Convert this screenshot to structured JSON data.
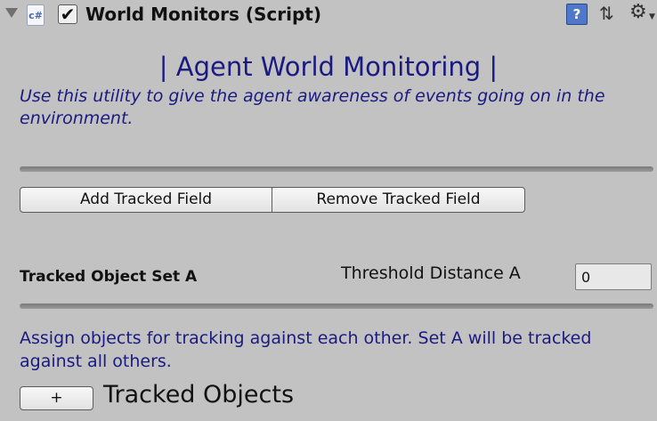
{
  "component": {
    "title": "World Monitors (Script)",
    "script_icon_label": "c#",
    "enabled": true,
    "enabled_glyph": "✔",
    "icons": [
      "foldout-arrow-icon",
      "csharp-script-icon",
      "help-icon",
      "preset-icon",
      "gear-icon"
    ]
  },
  "header": {
    "title": "| Agent World Monitoring |",
    "description": "Use this utility to give the agent awareness of events going on in the environment."
  },
  "buttons": {
    "add_tracked_field": "Add Tracked Field",
    "remove_tracked_field": "Remove Tracked Field"
  },
  "set_a": {
    "label": "Tracked Object Set A",
    "threshold_label": "Threshold Distance A",
    "threshold_value": "0"
  },
  "tracking": {
    "description": "Assign objects for tracking against each other. Set A will be tracked against all others.",
    "add_button": "+",
    "list_title": "Tracked Objects"
  },
  "colors": {
    "panel_bg": "#c2c2c2",
    "accent_text": "#1a1a80"
  }
}
